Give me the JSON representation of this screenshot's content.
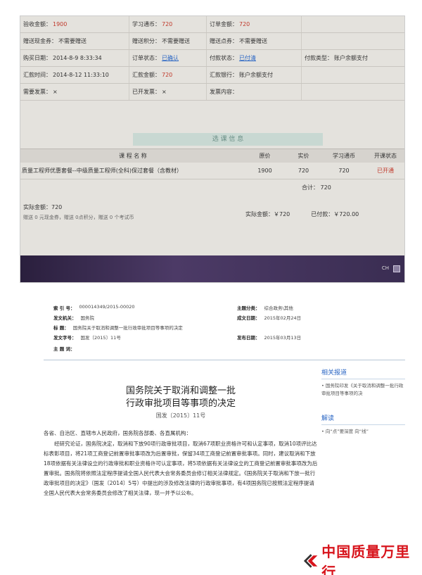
{
  "order": {
    "rows": [
      [
        {
          "label": "验收金额：",
          "value": "1900",
          "tone": "red"
        },
        {
          "label": "学习通币：",
          "value": "720",
          "tone": "red"
        },
        {
          "label": "订单金额：",
          "value": "720",
          "tone": "red"
        },
        {
          "label": "",
          "value": "",
          "tone": "dark"
        }
      ],
      [
        {
          "label": "赠送现金券：",
          "value": "不需要赠送",
          "tone": "dark"
        },
        {
          "label": "赠送积分：",
          "value": "不需要赠送",
          "tone": "dark"
        },
        {
          "label": "赠送点券：",
          "value": "不需要赠送",
          "tone": "dark"
        },
        {
          "label": "",
          "value": "",
          "tone": "dark"
        }
      ],
      [
        {
          "label": "购买日期：",
          "value": "2014-8-9 8:33:34",
          "tone": "dark"
        },
        {
          "label": "订单状态：",
          "value": "已确认",
          "tone": "blue"
        },
        {
          "label": "付款状态：",
          "value": "已付清",
          "tone": "blue"
        },
        {
          "label": "付款类型：",
          "value": "账户余额支付",
          "tone": "dark"
        }
      ],
      [
        {
          "label": "汇款时间：",
          "value": "2014-8-12 11:33:10",
          "tone": "dark"
        },
        {
          "label": "汇款金额：",
          "value": "720",
          "tone": "red"
        },
        {
          "label": "汇款银行：",
          "value": "账户余额支付",
          "tone": "dark"
        },
        {
          "label": "",
          "value": "",
          "tone": "dark"
        }
      ],
      [
        {
          "label": "需要发票：",
          "value": "×",
          "tone": "dark"
        },
        {
          "label": "已开发票：",
          "value": "×",
          "tone": "dark"
        },
        {
          "label": "发票内容：",
          "value": "",
          "tone": "dark"
        },
        {
          "label": "",
          "value": "",
          "tone": "dark"
        }
      ]
    ],
    "section_title": "选 课 信 息",
    "course_headers": [
      "课 程 名 称",
      "原价",
      "实价",
      "学习通币",
      "开课状态"
    ],
    "course": {
      "name": "质量工程师优惠套餐--中级质量工程师(全科)保过套餐（含教材）",
      "original": "1900",
      "actual": "720",
      "coins": "720",
      "status": "已开通"
    },
    "total_label": "合计：",
    "total_value": "720",
    "summary_amount": "实际金额：720",
    "summary_bonus": "赠送 0 元现金券，赠送 0点积分，赠送 0 个考试币",
    "actual_label": "实际金额：",
    "actual_value": "￥720",
    "paid_label": "已付款：",
    "paid_value": "￥720.00",
    "taskbar_text": "CH"
  },
  "doc": {
    "meta_left": [
      {
        "label": "索 引 号：",
        "value": "000014349/2015-00020"
      },
      {
        "label": "发文机关：",
        "value": "国务院"
      },
      {
        "label": "标    题：",
        "value": "国务院关于取消和调整一批行政审批项目等事项的决定"
      },
      {
        "label": "发文字号：",
        "value": "国发〔2015〕11号"
      },
      {
        "label": "主 题 词：",
        "value": ""
      }
    ],
    "meta_right": [
      {
        "label": "主题分类：",
        "value": "综合政务\\其他"
      },
      {
        "label": "成文日期：",
        "value": "2015年02月24日"
      },
      {
        "label": "发布日期：",
        "value": "2015年03月13日"
      }
    ],
    "title_line1": "国务院关于取消和调整一批",
    "title_line2": "行政审批项目等事项的决定",
    "doc_number": "国发〔2015〕11号",
    "addressee": "各省、自治区、直辖市人民政府，国务院各部委、各直属机构：",
    "body": "经研究论证，国务院决定，取消和下放90项行政审批项目，取消67项职业资格许可和认定事项，取消10项评比达标表彰项目，将21项工商登记前置审批事项改为后置审批，保留34项工商登记前置审批事项。同时，建议取消和下放18项依据有关法律设立的行政审批和职业资格许可认定事项，将5项依据有关法律设立的工商登记前置审批事项改为后置审批。国务院将依照法定程序提请全国人民代表大会常务委员会修订相关法律规定。《国务院关于取消和下放一批行政审批项目的决定》（国发〔2014〕5号）中提出的涉及修改法律的行政审批事项，有4项国务院已按照法定程序提请全国人民代表大会常务委员会修改了相关法律，现一并予以公布。",
    "side_title1": "相关报道",
    "side_item1": "• 国务院印发《关于取消和调整一批行政审批项目等事项的决",
    "side_title2": "解读",
    "side_item2": "• 向“点”要深度 向“线”"
  },
  "watermark": "中国质量万里行"
}
